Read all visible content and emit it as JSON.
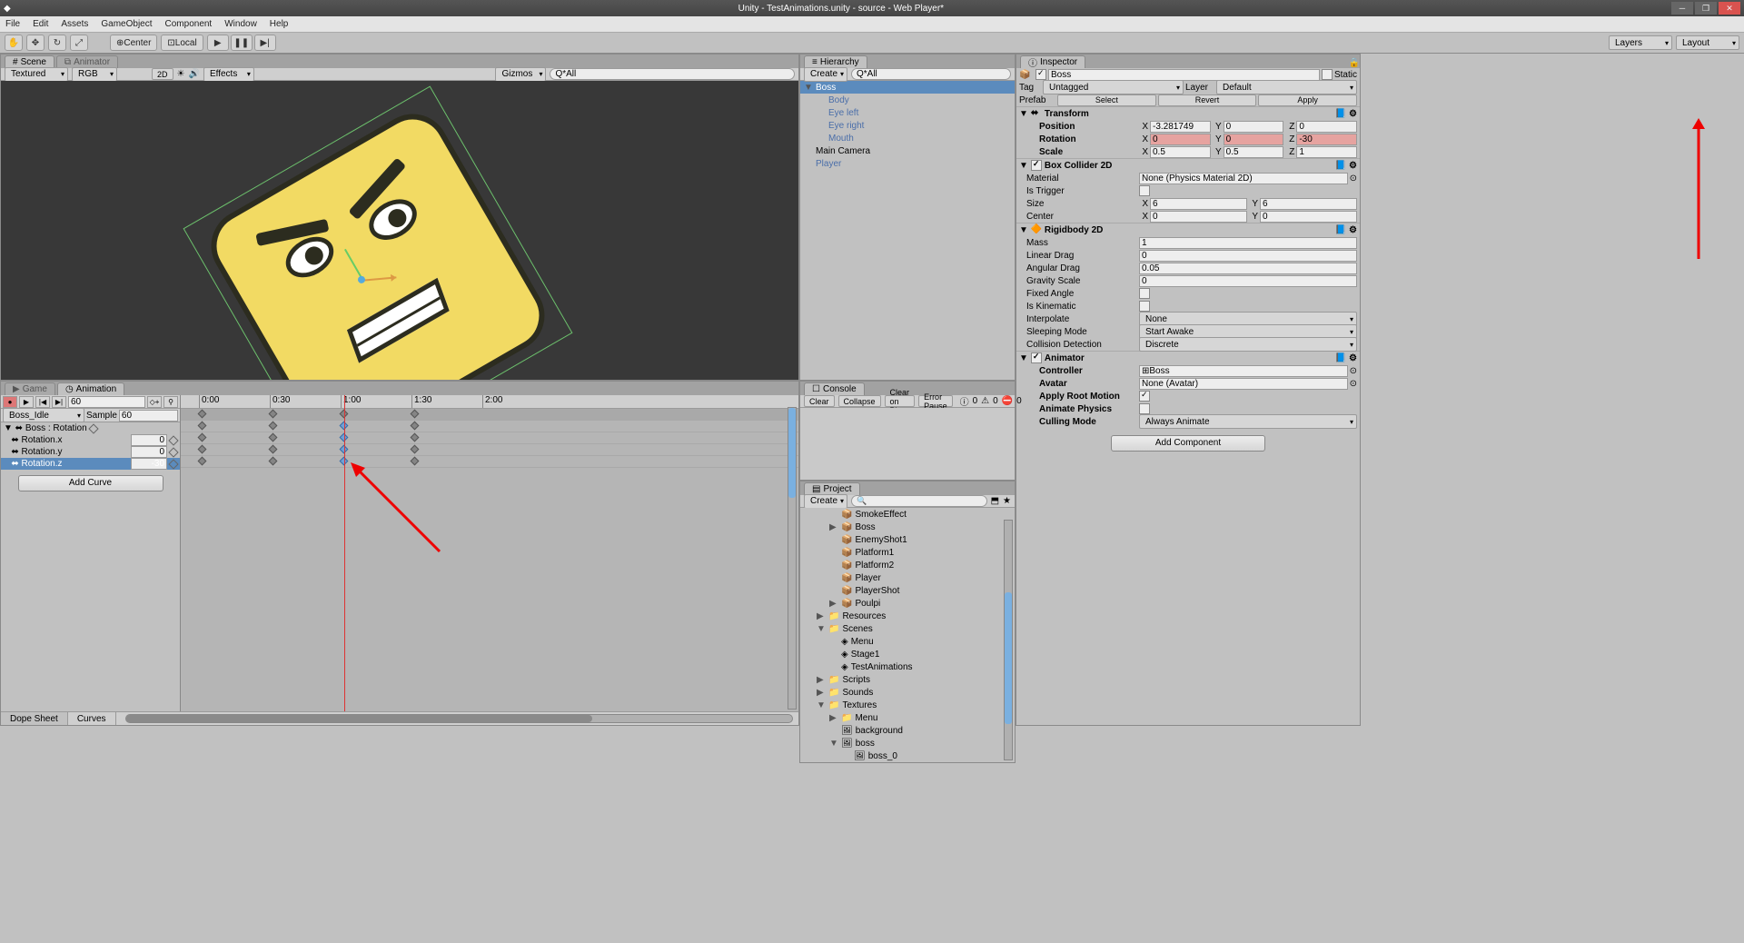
{
  "title": "Unity - TestAnimations.unity - source - Web Player*",
  "menubar": [
    "File",
    "Edit",
    "Assets",
    "GameObject",
    "Component",
    "Window",
    "Help"
  ],
  "toolbar": {
    "center": "Center",
    "local": "Local",
    "layers": "Layers",
    "layout": "Layout"
  },
  "scene": {
    "tabs": [
      "Scene",
      "Animator"
    ],
    "shading": "Textured",
    "render": "RGB",
    "twod": "2D",
    "effects": "Effects",
    "gizmos": "Gizmos",
    "search": "Q*All"
  },
  "hierarchy": {
    "title": "Hierarchy",
    "create": "Create",
    "search": "Q*All",
    "items": [
      {
        "name": "Boss",
        "sel": true,
        "exp": "▼"
      },
      {
        "name": "Body",
        "ind": 1,
        "link": true
      },
      {
        "name": "Eye left",
        "ind": 1,
        "link": true
      },
      {
        "name": "Eye right",
        "ind": 1,
        "link": true
      },
      {
        "name": "Mouth",
        "ind": 1,
        "link": true
      },
      {
        "name": "Main Camera",
        "ind": 0
      },
      {
        "name": "Player",
        "ind": 0,
        "link": true
      }
    ]
  },
  "inspector": {
    "title": "Inspector",
    "name": "Boss",
    "static": "Static",
    "tag_lbl": "Tag",
    "tag": "Untagged",
    "layer_lbl": "Layer",
    "layer": "Default",
    "prefab": {
      "lbl": "Prefab",
      "select": "Select",
      "revert": "Revert",
      "apply": "Apply"
    },
    "transform": {
      "title": "Transform",
      "position": {
        "lbl": "Position",
        "x": "-3.281749",
        "y": "0",
        "z": "0"
      },
      "rotation": {
        "lbl": "Rotation",
        "x": "0",
        "y": "0",
        "z": "-30"
      },
      "scale": {
        "lbl": "Scale",
        "x": "0.5",
        "y": "0.5",
        "z": "1"
      }
    },
    "boxcol": {
      "title": "Box Collider 2D",
      "material_lbl": "Material",
      "material": "None (Physics Material 2D)",
      "istrigger": "Is Trigger",
      "size": {
        "lbl": "Size",
        "x": "6",
        "y": "6"
      },
      "center": {
        "lbl": "Center",
        "x": "0",
        "y": "0"
      }
    },
    "rigidbody": {
      "title": "Rigidbody 2D",
      "mass_lbl": "Mass",
      "mass": "1",
      "ldrag_lbl": "Linear Drag",
      "ldrag": "0",
      "adrag_lbl": "Angular Drag",
      "adrag": "0.05",
      "gscale_lbl": "Gravity Scale",
      "gscale": "0",
      "fangle": "Fixed Angle",
      "iskin": "Is Kinematic",
      "interp_lbl": "Interpolate",
      "interp": "None",
      "sleep_lbl": "Sleeping Mode",
      "sleep": "Start Awake",
      "coll_lbl": "Collision Detection",
      "coll": "Discrete"
    },
    "animator": {
      "title": "Animator",
      "ctrl_lbl": "Controller",
      "ctrl": "Boss",
      "avatar_lbl": "Avatar",
      "avatar": "None (Avatar)",
      "root": "Apply Root Motion",
      "aphys": "Animate Physics",
      "cull_lbl": "Culling Mode",
      "cull": "Always Animate"
    },
    "addcomp": "Add Component"
  },
  "animation": {
    "tabs": [
      "Game",
      "Animation"
    ],
    "frame": "60",
    "clip": "Boss_Idle",
    "sample_lbl": "Sample",
    "sample": "60",
    "ticks": [
      "0:00",
      "0:30",
      "1:00",
      "1:30",
      "2:00"
    ],
    "props": [
      {
        "name": "Boss : Rotation",
        "header": true
      },
      {
        "name": "Rotation.x",
        "val": "0"
      },
      {
        "name": "Rotation.y",
        "val": "0"
      },
      {
        "name": "Rotation.z",
        "val": "-30",
        "sel": true
      }
    ],
    "addcurve": "Add Curve",
    "dopesheet": "Dope Sheet",
    "curves": "Curves"
  },
  "console": {
    "title": "Console",
    "clear": "Clear",
    "collapse": "Collapse",
    "cop": "Clear on Play",
    "ep": "Error Pause",
    "c0": "0",
    "c1": "0",
    "c2": "0"
  },
  "project": {
    "title": "Project",
    "create": "Create",
    "items": [
      {
        "name": "SmokeEffect",
        "ind": 2,
        "ico": "prefab"
      },
      {
        "name": "Boss",
        "ind": 2,
        "ico": "prefab",
        "exp": "▶"
      },
      {
        "name": "EnemyShot1",
        "ind": 2,
        "ico": "prefab"
      },
      {
        "name": "Platform1",
        "ind": 2,
        "ico": "prefab"
      },
      {
        "name": "Platform2",
        "ind": 2,
        "ico": "prefab"
      },
      {
        "name": "Player",
        "ind": 2,
        "ico": "prefab"
      },
      {
        "name": "PlayerShot",
        "ind": 2,
        "ico": "prefab"
      },
      {
        "name": "Poulpi",
        "ind": 2,
        "ico": "prefab",
        "exp": "▶"
      },
      {
        "name": "Resources",
        "ind": 1,
        "ico": "folder",
        "exp": "▶"
      },
      {
        "name": "Scenes",
        "ind": 1,
        "ico": "folder",
        "exp": "▼"
      },
      {
        "name": "Menu",
        "ind": 2,
        "ico": "scene"
      },
      {
        "name": "Stage1",
        "ind": 2,
        "ico": "scene"
      },
      {
        "name": "TestAnimations",
        "ind": 2,
        "ico": "scene"
      },
      {
        "name": "Scripts",
        "ind": 1,
        "ico": "folder",
        "exp": "▶"
      },
      {
        "name": "Sounds",
        "ind": 1,
        "ico": "folder",
        "exp": "▶"
      },
      {
        "name": "Textures",
        "ind": 1,
        "ico": "folder",
        "exp": "▼"
      },
      {
        "name": "Menu",
        "ind": 2,
        "ico": "folder",
        "exp": "▶"
      },
      {
        "name": "background",
        "ind": 2,
        "ico": "tex"
      },
      {
        "name": "boss",
        "ind": 2,
        "ico": "tex",
        "exp": "▼"
      },
      {
        "name": "boss_0",
        "ind": 3,
        "ico": "tex"
      }
    ]
  }
}
